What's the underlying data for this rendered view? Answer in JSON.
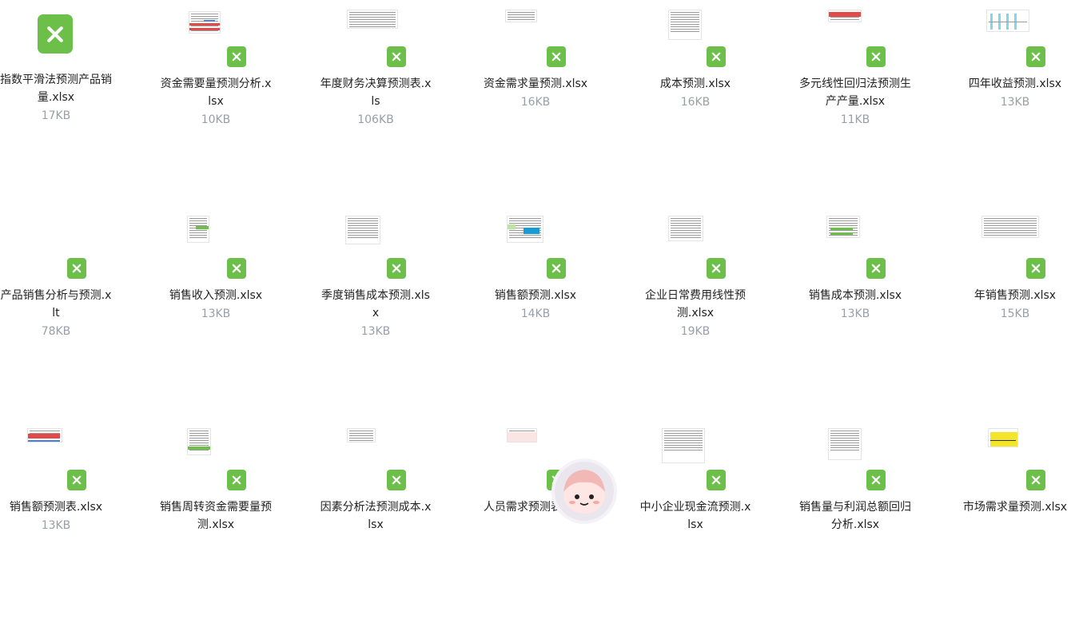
{
  "accent_color": "#6cc04a",
  "file_icon": "excel-file-icon",
  "files": [
    {
      "name": "指数平滑法预测产品销量.xlsx",
      "size": "17KB",
      "thumb": "none"
    },
    {
      "name": "资金需要量预测分析.xlsx",
      "size": "10KB",
      "thumb": "red-table"
    },
    {
      "name": "年度财务决算预测表.xls",
      "size": "106KB",
      "thumb": "grid"
    },
    {
      "name": "资金需求量预测.xlsx",
      "size": "16KB",
      "thumb": "small-table"
    },
    {
      "name": "成本预测.xlsx",
      "size": "16KB",
      "thumb": "text-sparse"
    },
    {
      "name": "多元线性回归法预测生产产量.xlsx",
      "size": "11KB",
      "thumb": "red-header"
    },
    {
      "name": "四年收益预测.xlsx",
      "size": "13KB",
      "thumb": "cyan-bars"
    },
    {
      "name": "产品销售分析与预测.xlt",
      "size": "78KB",
      "thumb": "none-small"
    },
    {
      "name": "销售收入预测.xlsx",
      "size": "13KB",
      "thumb": "green-form"
    },
    {
      "name": "季度销售成本预测.xlsx",
      "size": "13KB",
      "thumb": "text-doc"
    },
    {
      "name": "销售额预测.xlsx",
      "size": "14KB",
      "thumb": "blue-table"
    },
    {
      "name": "企业日常费用线性预测.xlsx",
      "size": "19KB",
      "thumb": "dense-table"
    },
    {
      "name": "销售成本预测.xlsx",
      "size": "13KB",
      "thumb": "green-rows"
    },
    {
      "name": "年销售预测.xlsx",
      "size": "15KB",
      "thumb": "wide-table"
    },
    {
      "name": "销售额预测表.xlsx",
      "size": "13KB",
      "thumb": "red-band"
    },
    {
      "name": "销售周转资金需要量预测.xlsx",
      "size": "",
      "thumb": "green-footer"
    },
    {
      "name": "因素分析法预测成本.xlsx",
      "size": "",
      "thumb": "gray-table"
    },
    {
      "name": "人员需求预测表.xlsx",
      "size": "",
      "thumb": "pink-table"
    },
    {
      "name": "中小企业现金流预测.xlsx",
      "size": "",
      "thumb": "tall-table"
    },
    {
      "name": "销售量与利润总额回归分析.xlsx",
      "size": "",
      "thumb": "list-doc"
    },
    {
      "name": "市场需求量预测.xlsx",
      "size": "",
      "thumb": "yellow-chart"
    }
  ]
}
